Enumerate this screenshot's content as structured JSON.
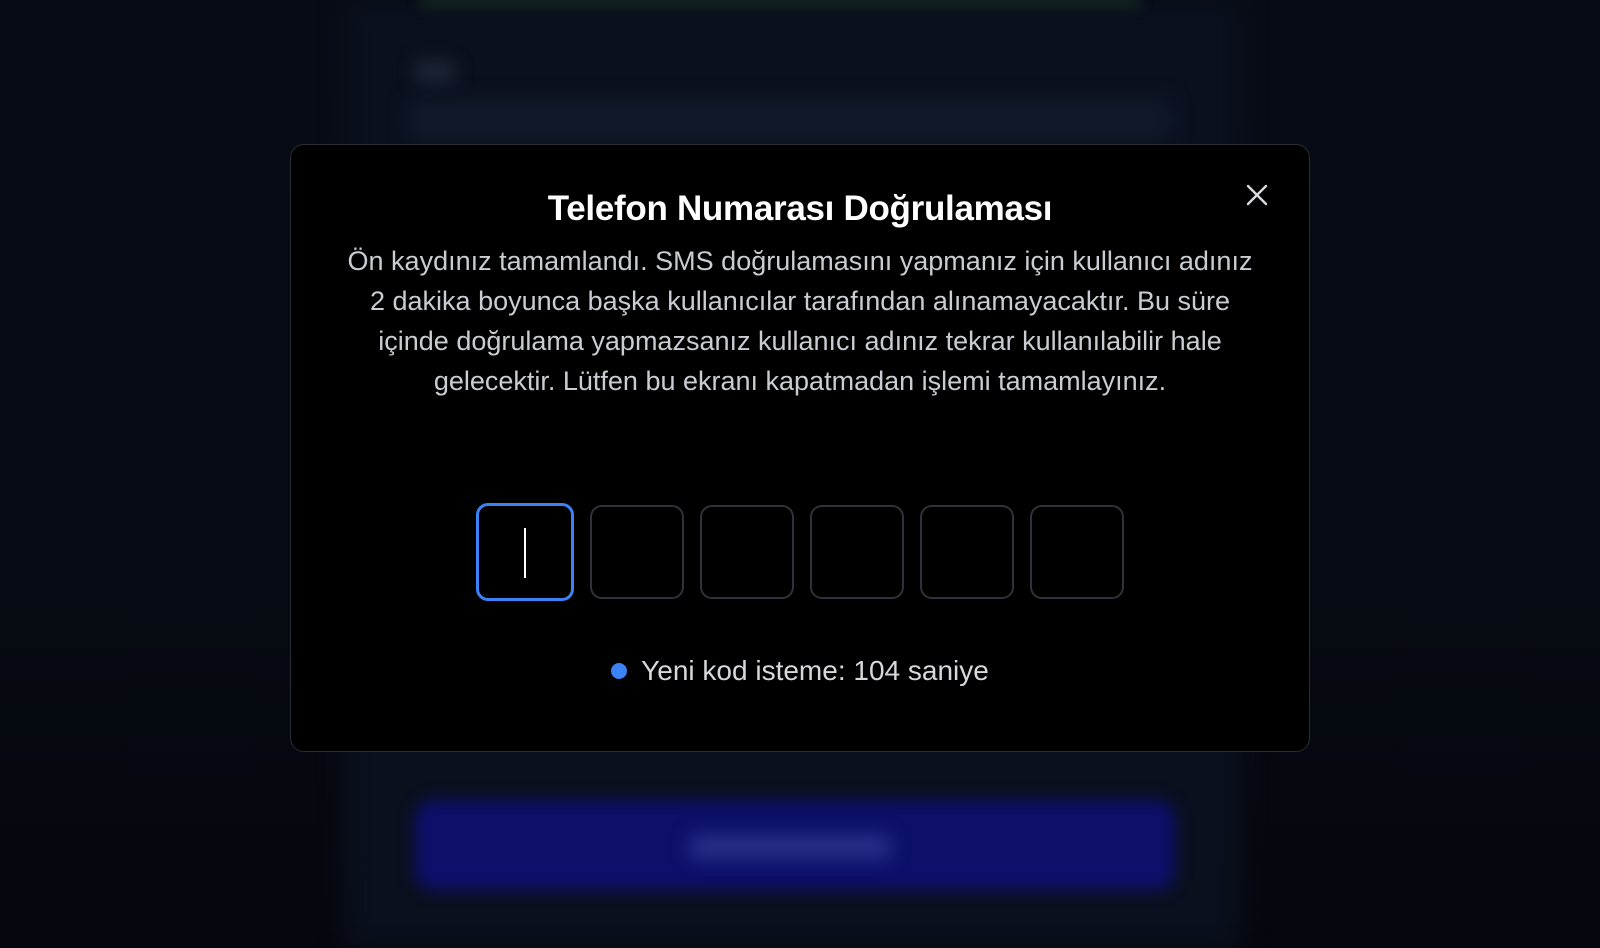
{
  "modal": {
    "title": "Telefon Numarası Doğrulaması",
    "description": "Ön kaydınız tamamlandı. SMS doğrulamasını yapmanız için kullanıcı adınız 2 dakika boyunca başka kullanıcılar tarafından alınamayacaktır. Bu süre içinde doğrulama yapmazsanız kullanıcı adınız tekrar kullanılabilir hale gelecektir. Lütfen bu ekranı kapatmadan işlemi tamamlayınız.",
    "close_icon": "close-icon",
    "otp": {
      "digits": [
        "",
        "",
        "",
        "",
        "",
        ""
      ],
      "active_index": 0
    },
    "resend": {
      "text": "Yeni kod isteme: 104 saniye",
      "dot_color": "#3b82f6"
    }
  },
  "colors": {
    "accent": "#3b82f6",
    "modal_bg": "#000000",
    "backdrop": "#05080f"
  }
}
